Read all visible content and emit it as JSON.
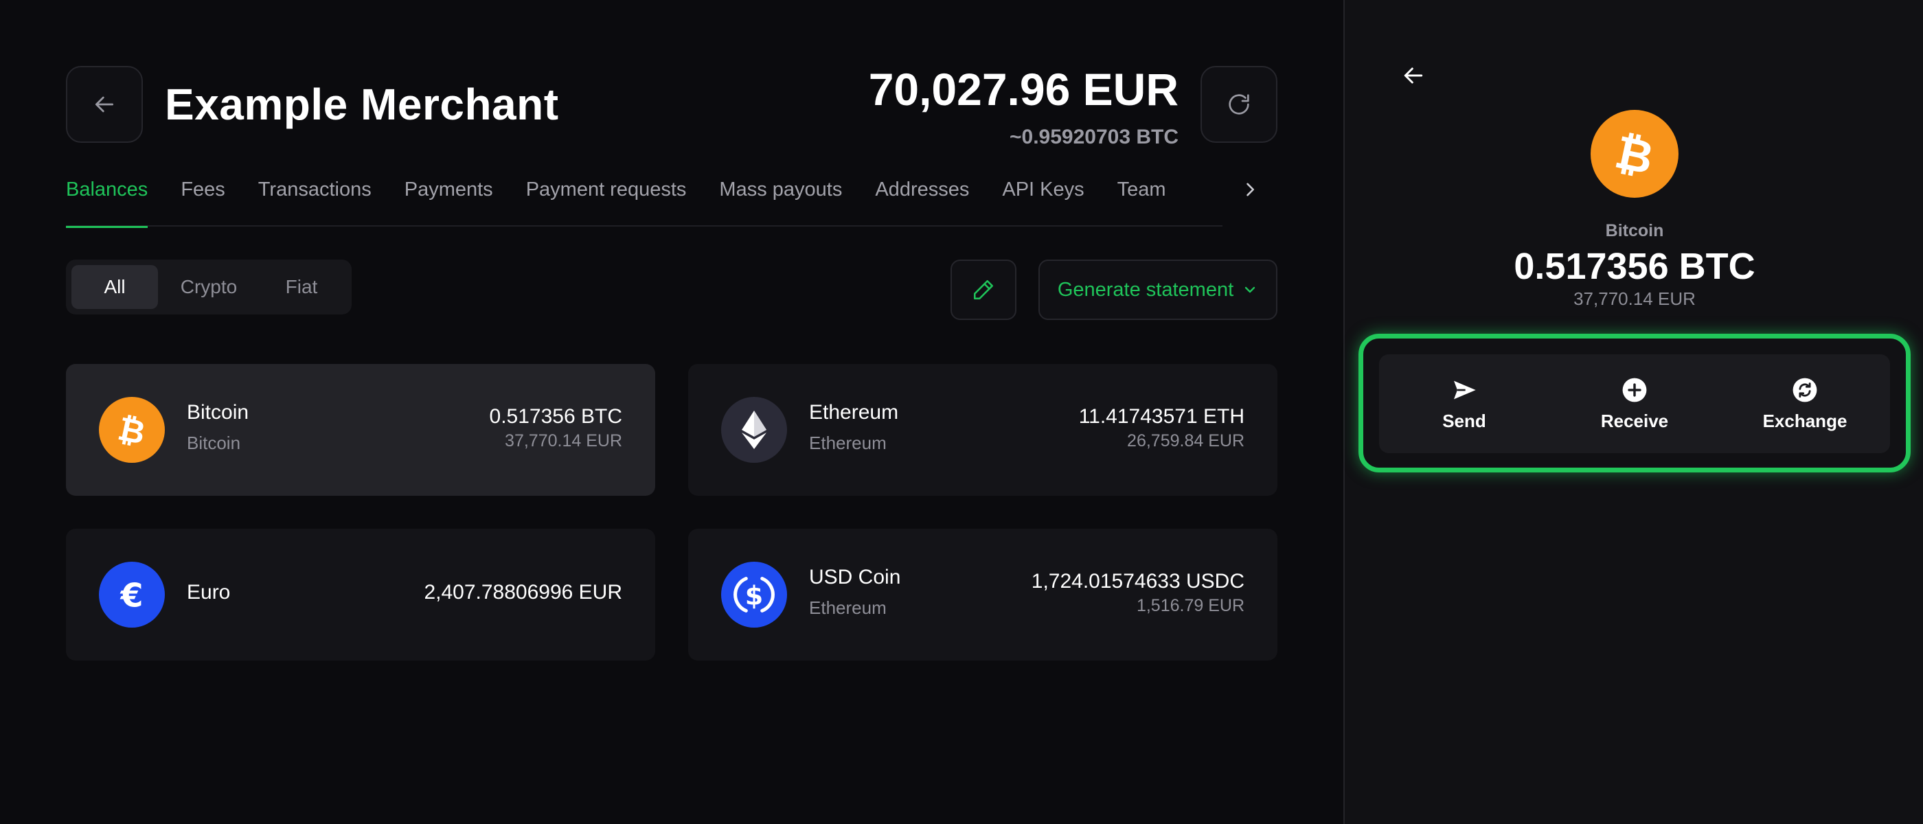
{
  "header": {
    "title": "Example Merchant",
    "total_amount": "70,027.96 EUR",
    "total_btc": "~0.95920703 BTC"
  },
  "tabs": [
    {
      "label": "Balances",
      "active": true
    },
    {
      "label": "Fees"
    },
    {
      "label": "Transactions"
    },
    {
      "label": "Payments"
    },
    {
      "label": "Payment requests"
    },
    {
      "label": "Mass payouts"
    },
    {
      "label": "Addresses"
    },
    {
      "label": "API Keys"
    },
    {
      "label": "Team"
    }
  ],
  "filter": {
    "options": [
      "All",
      "Crypto",
      "Fiat"
    ],
    "selected": "All"
  },
  "toolbar": {
    "generate_statement_label": "Generate statement"
  },
  "balances": [
    {
      "name": "Bitcoin",
      "network": "Bitcoin",
      "amount": "0.517356 BTC",
      "fiat": "37,770.14 EUR",
      "icon": "bitcoin-icon",
      "color": "#f7931a",
      "selected": true
    },
    {
      "name": "Ethereum",
      "network": "Ethereum",
      "amount": "11.41743571 ETH",
      "fiat": "26,759.84 EUR",
      "icon": "ethereum-icon",
      "color": "#2b2b38"
    },
    {
      "name": "Euro",
      "network": "",
      "amount": "2,407.78806996 EUR",
      "fiat": "",
      "icon": "euro-icon",
      "color": "#1f4cf0"
    },
    {
      "name": "USD Coin",
      "network": "Ethereum",
      "amount": "1,724.01574633 USDC",
      "fiat": "1,516.79 EUR",
      "icon": "usdc-icon",
      "color": "#1f4cf0"
    }
  ],
  "panel": {
    "coin_name": "Bitcoin",
    "amount": "0.517356 BTC",
    "fiat": "37,770.14 EUR",
    "actions": [
      {
        "label": "Send",
        "icon": "send-icon"
      },
      {
        "label": "Receive",
        "icon": "plus-circle-icon"
      },
      {
        "label": "Exchange",
        "icon": "exchange-icon"
      }
    ]
  },
  "colors": {
    "accent": "#1fc45a",
    "bitcoin": "#f7931a",
    "euro": "#1f4cf0"
  }
}
